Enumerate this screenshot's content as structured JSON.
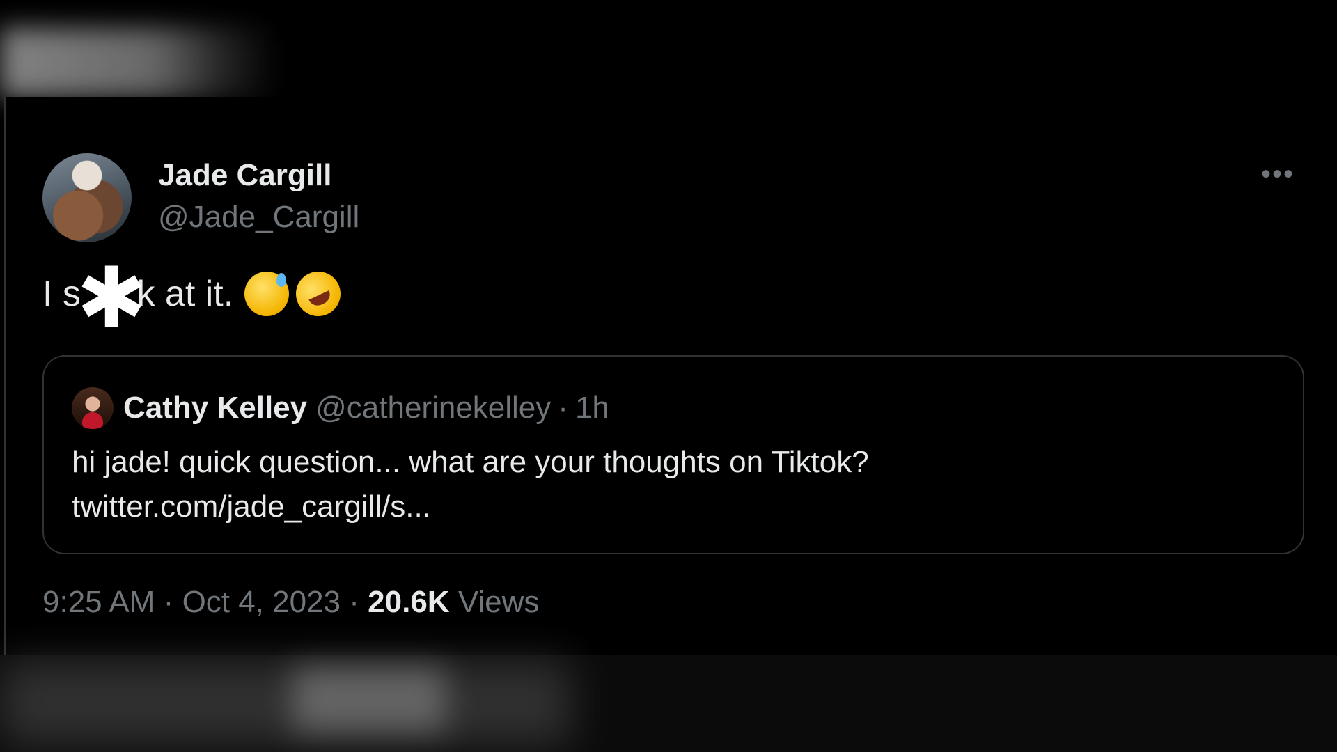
{
  "author": {
    "display_name": "Jade Cargill",
    "handle": "@Jade_Cargill"
  },
  "tweet": {
    "text_before": "I s",
    "text_after": "k at it.",
    "emojis": [
      "grinning-face-with-sweat",
      "rolling-on-the-floor-laughing"
    ]
  },
  "quoted": {
    "display_name": "Cathy Kelley",
    "handle": "@catherinekelley",
    "separator": "·",
    "time": "1h",
    "line1": "hi jade! quick question... what are your thoughts on Tiktok?",
    "line2": "twitter.com/jade_cargill/s..."
  },
  "meta": {
    "time": "9:25 AM",
    "separator": "·",
    "date": "Oct 4, 2023",
    "views_count": "20.6K",
    "views_label": "Views"
  },
  "more_icon": "more-horizontal-icon",
  "redaction_icon": "asterisk-icon",
  "colors": {
    "background": "#000000",
    "primary_text": "#e7e9ea",
    "secondary_text": "#71767b",
    "border": "#2f3336"
  }
}
